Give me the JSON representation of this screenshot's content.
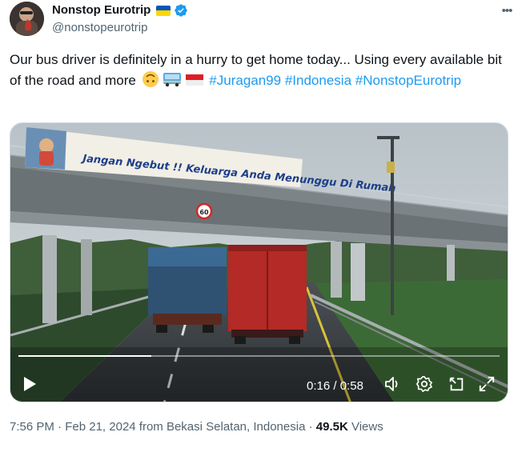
{
  "author": {
    "display_name": "Nonstop Eurotrip",
    "handle": "@nonstopeurotrip"
  },
  "more_label": "•••",
  "tweet": {
    "text_before": "Our bus driver is definitely in a hurry to get home today... Using every available bit of the road and more",
    "hashtags": [
      "#Juragan99",
      "#Indonesia",
      "#NonstopEurotrip"
    ]
  },
  "video": {
    "banner_text": "Jangan Ngebut !! Keluarga Anda Menunggu Di Rumah",
    "time_current": "0:16",
    "time_total": "0:58",
    "time_separator": " / ",
    "progress_fraction": 0.276
  },
  "meta": {
    "time": "7:56 PM",
    "date": "Feb 21, 2024",
    "location": "from Bekasi Selatan, Indonesia",
    "views_count": "49.5K",
    "views_label": "Views",
    "separator": "·"
  },
  "colors": {
    "accent": "#1d9bf0",
    "muted": "#536471",
    "text": "#0f1419"
  }
}
